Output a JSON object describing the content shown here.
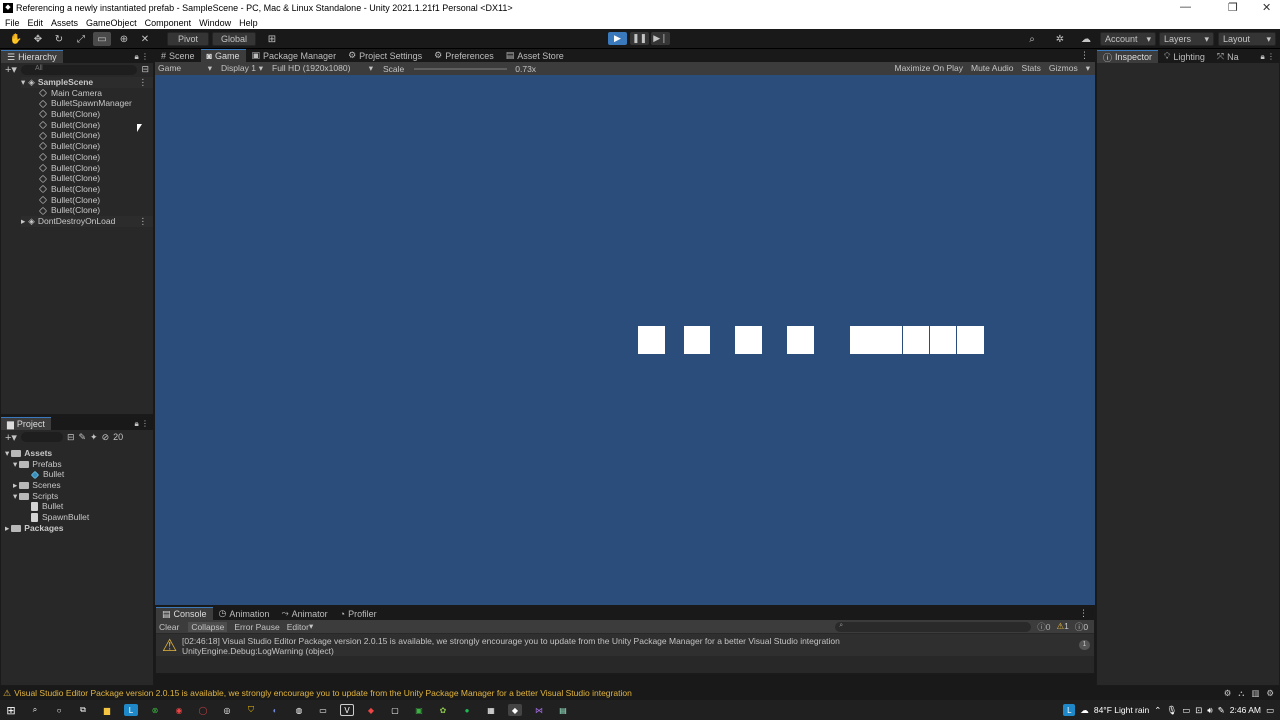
{
  "window": {
    "title": "Referencing a newly instantiated prefab - SampleScene - PC, Mac & Linux Standalone - Unity 2021.1.21f1 Personal <DX11>"
  },
  "menu": [
    "File",
    "Edit",
    "Assets",
    "GameObject",
    "Component",
    "Window",
    "Help"
  ],
  "toolbar": {
    "pivot": "Pivot",
    "global": "Global",
    "account": "Account",
    "layers": "Layers",
    "layout": "Layout"
  },
  "hierarchy": {
    "tab": "Hierarchy",
    "search_placeholder": "All",
    "scene": "SampleScene",
    "items": [
      "Main Camera",
      "BulletSpawnManager",
      "Bullet(Clone)",
      "Bullet(Clone)",
      "Bullet(Clone)",
      "Bullet(Clone)",
      "Bullet(Clone)",
      "Bullet(Clone)",
      "Bullet(Clone)",
      "Bullet(Clone)",
      "Bullet(Clone)",
      "Bullet(Clone)"
    ],
    "dontdestroy": "DontDestroyOnLoad"
  },
  "center_tabs": [
    "Scene",
    "Game",
    "Package Manager",
    "Project Settings",
    "Preferences",
    "Asset Store"
  ],
  "game_bar": {
    "mode": "Game",
    "display": "Display 1",
    "resolution": "Full HD (1920x1080)",
    "scale_label": "Scale",
    "scale_value": "0.73x",
    "maximize": "Maximize On Play",
    "mute": "Mute Audio",
    "stats": "Stats",
    "gizmos": "Gizmos"
  },
  "right_tabs": [
    "Inspector",
    "Lighting",
    "Na"
  ],
  "project": {
    "tab": "Project",
    "count": "20",
    "assets": "Assets",
    "prefabs": "Prefabs",
    "bullet_prefab": "Bullet",
    "scenes": "Scenes",
    "scripts": "Scripts",
    "bullet_script": "Bullet",
    "spawn_script": "SpawnBullet",
    "packages": "Packages"
  },
  "bottom_tabs": [
    "Console",
    "Animation",
    "Animator",
    "Profiler"
  ],
  "console": {
    "clear": "Clear",
    "collapse": "Collapse",
    "error_pause": "Error Pause",
    "editor": "Editor",
    "count_errors": "0",
    "count_warnings": "1",
    "count_info": "0",
    "line1": "[02:46:18] Visual Studio Editor Package version 2.0.15 is available, we strongly encourage you to update from the Unity Package Manager for a better Visual Studio integration",
    "line2": "UnityEngine.Debug:LogWarning (object)",
    "collapse_count": "1"
  },
  "status": "Visual Studio Editor Package version 2.0.15 is available, we strongly encourage you to update from the Unity Package Manager for a better Visual Studio integration",
  "taskbar": {
    "weather": "84°F  Light rain",
    "time": "2:46 AM"
  },
  "colors": {
    "game_bg": "#2b4d7b",
    "panel": "#282828",
    "accent": "#3a79bb",
    "warning": "#e3b53c"
  }
}
